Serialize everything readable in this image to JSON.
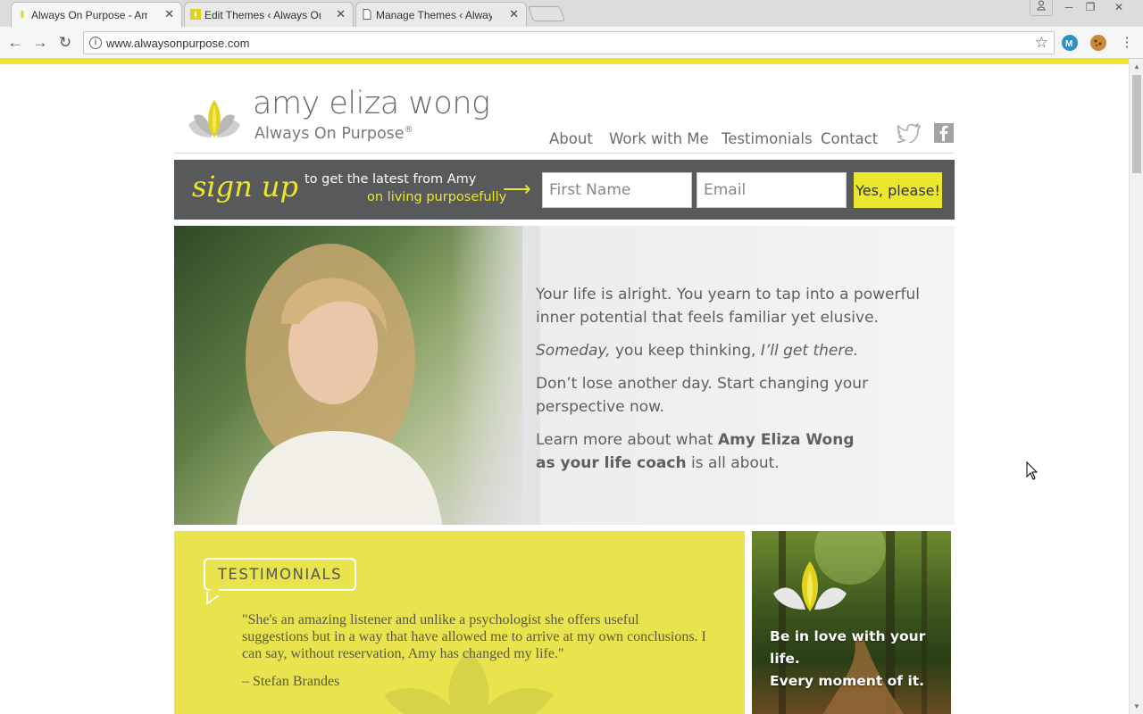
{
  "browser": {
    "tabs": [
      {
        "title": "Always On Purpose - Am",
        "close": "✕",
        "active": true
      },
      {
        "title": "Edit Themes ‹ Always On",
        "close": "✕",
        "active": false
      },
      {
        "title": "Manage Themes ‹ Alway",
        "close": "✕",
        "active": false
      }
    ],
    "url": "www.alwaysonpurpose.com",
    "colors": {
      "accent": "#ece62d"
    }
  },
  "site": {
    "logo_name": "amy eliza wong",
    "logo_sub": "Always On Purpose",
    "logo_reg": "®",
    "nav": [
      "About",
      "Work with Me",
      "Testimonials",
      "Contact"
    ],
    "social": [
      "twitter-icon",
      "facebook-icon"
    ]
  },
  "signup": {
    "big": "sign up",
    "line1": "to get the latest from Amy",
    "line2": "on living purposefully",
    "arrow": "⟶",
    "first_name_placeholder": "First Name",
    "email_placeholder": "Email",
    "submit": "Yes, please!"
  },
  "hero": {
    "p1": "Your life is alright. You yearn to tap into a powerful inner potential that feels familiar yet elusive.",
    "p2_a": "Someday,",
    "p2_b": " you keep thinking, ",
    "p2_c": "I’ll get there.",
    "p3": "Don’t lose another day. Start changing your perspective now.",
    "p4_a": "Learn more about what ",
    "p4_b": "Amy Eliza Wong as your life coach",
    "p4_c": " is all about."
  },
  "testimonials": {
    "label": "TESTIMONIALS",
    "quote": "\"She's an amazing listener and unlike a psychologist she offers useful suggestions but in a way that have allowed me to arrive at my own conclusions.   I can say, without reservation, Amy has changed my life.\"",
    "author": "– Stefan Brandes"
  },
  "promo": {
    "line1": "Be in love with your life.",
    "line2": "Every moment of it."
  }
}
